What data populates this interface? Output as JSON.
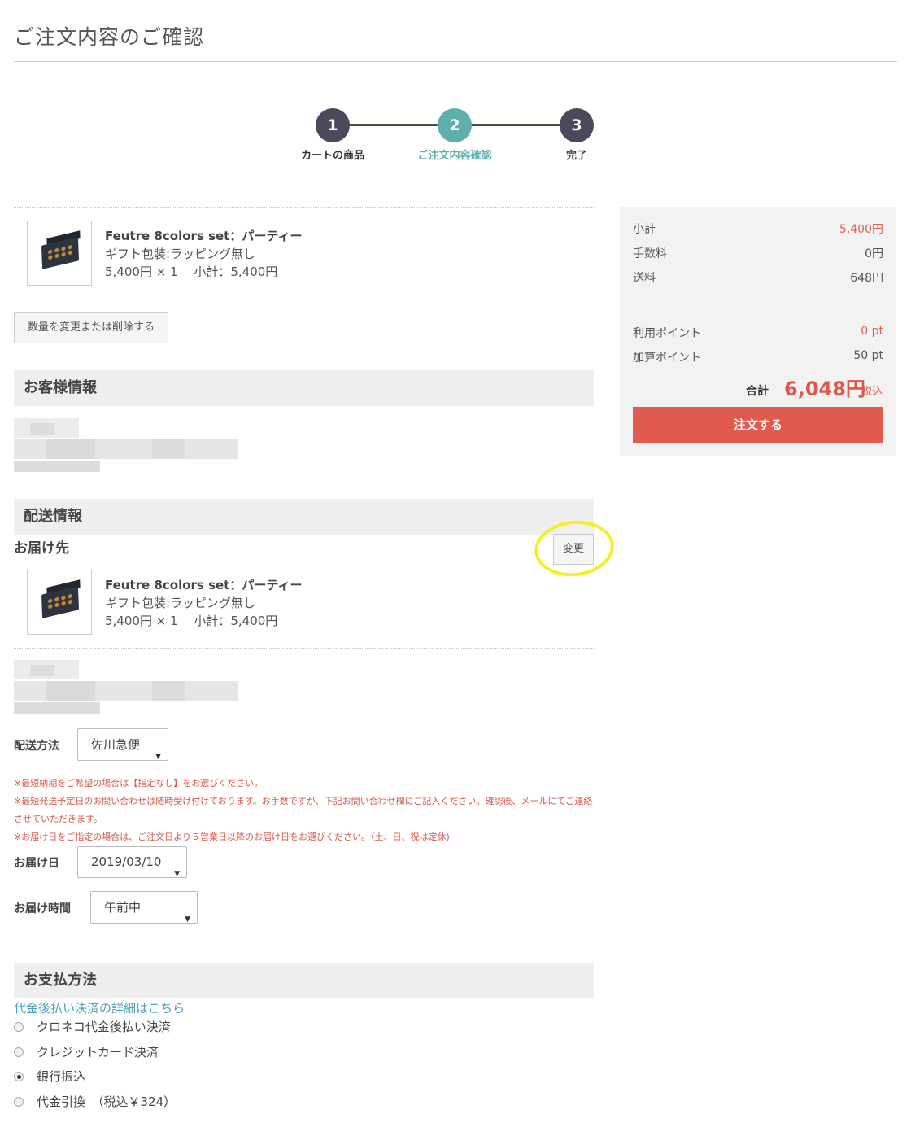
{
  "page": {
    "title": "ご注文内容のご確認"
  },
  "steps": [
    {
      "number": "1",
      "label": "カートの商品"
    },
    {
      "number": "2",
      "label": "ご注文内容確認"
    },
    {
      "number": "3",
      "label": "完了"
    }
  ],
  "cart": {
    "item": {
      "name": "Feutre 8colors set：パーティー",
      "option": "ギフト包装:ラッピング無し",
      "price_line": "5,400円 × 1　 小計：5,400円"
    },
    "change_qty_button": "数量を変更または削除する"
  },
  "customer": {
    "heading": "お客様情報"
  },
  "shipping": {
    "heading": "配送情報",
    "destination_label": "お届け先",
    "change_button": "変更",
    "item": {
      "name": "Feutre 8colors set：パーティー",
      "option": "ギフト包装:ラッピング無し",
      "price_line": "5,400円 × 1　 小計：5,400円"
    },
    "method_label": "配送方法",
    "method_value": "佐川急便",
    "notices": [
      "※最短納期をご希望の場合は【指定なし】をお選びください。",
      "※最短発送予定日のお問い合わせは随時受け付けております。お手数ですが、下記お問い合わせ欄にご記入ください。確認後、メールにてご連絡させていただきます。",
      "※お届け日をご指定の場合は、ご注文日より５営業日以降のお届け日をお選びください。（土、日、祝は定休)"
    ],
    "date_label": "お届け日",
    "date_value": "2019/03/10",
    "time_label": "お届け時間",
    "time_value": "午前中"
  },
  "payment": {
    "heading": "お支払方法",
    "detail_link": "代金後払い決済の詳細はこちら",
    "options": [
      {
        "label": "クロネコ代金後払い決済",
        "selected": false
      },
      {
        "label": "クレジットカード決済",
        "selected": false
      },
      {
        "label": "銀行振込",
        "selected": true
      },
      {
        "label": "代金引換　（税込￥324）",
        "selected": false
      }
    ]
  },
  "summary": {
    "subtotal_label": "小計",
    "subtotal_value": "5,400円",
    "fee_label": "手数料",
    "fee_value": "0円",
    "shipping_label": "送料",
    "shipping_value": "648円",
    "used_points_label": "利用ポイント",
    "used_points_value": "0 pt",
    "earned_points_label": "加算ポイント",
    "earned_points_value": "50 pt",
    "total_label": "合計",
    "total_value": "6,048円",
    "tax_label": "税込",
    "order_button": "注文する"
  },
  "colors": {
    "accent": "#5fb0ad",
    "order_button": "#e05a4d",
    "step_dark": "#4a4a5c",
    "highlight": "#f5ef2a"
  }
}
